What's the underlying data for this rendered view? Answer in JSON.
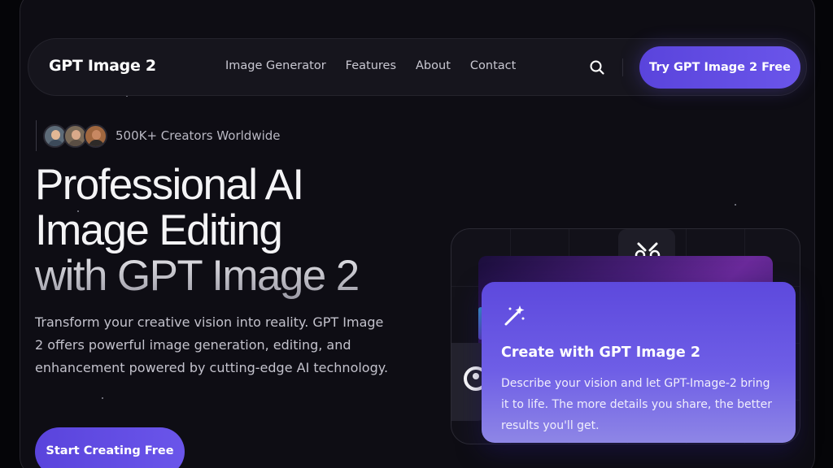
{
  "nav": {
    "brand": "GPT Image 2",
    "links": [
      "Image Generator",
      "Features",
      "About",
      "Contact"
    ],
    "cta": "Try GPT Image 2 Free"
  },
  "hero": {
    "creators": "500K+ Creators Worldwide",
    "title_lines": [
      "Professional AI",
      "Image Editing",
      "with GPT Image 2"
    ],
    "description": "Transform your creative vision into reality. GPT Image 2 offers powerful image generation, editing, and enhancement powered by cutting-edge AI technology.",
    "cta": "Start Creating Free"
  },
  "showcase": {
    "card_title": "Create with GPT Image 2",
    "card_description": "Describe your vision and let GPT-Image-2 bring it to life. The more details you share, the better results you'll get."
  },
  "colors": {
    "background": "#0e0d14",
    "accent": "#5a44dc",
    "card_accent": "#6e5ee6"
  },
  "icons": [
    "search-icon",
    "wrench-icon",
    "magic-wand-icon",
    "avatar-icon"
  ]
}
